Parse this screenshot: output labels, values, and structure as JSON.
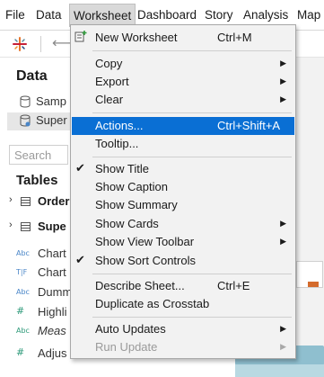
{
  "menubar": {
    "items": [
      "File",
      "Data",
      "Worksheet",
      "Dashboard",
      "Story",
      "Analysis",
      "Map"
    ]
  },
  "data_pane": {
    "title": "Data",
    "sources": [
      "Samp",
      "Super"
    ],
    "search_placeholder": "Search",
    "tables_title": "Tables",
    "tables": [
      "Order",
      "Supe"
    ],
    "fields": [
      {
        "type": "Abc",
        "label": "Chart"
      },
      {
        "type": "T|F",
        "label": "Chart"
      },
      {
        "type": "Abc",
        "label": "Dumm"
      },
      {
        "type": "#",
        "label": "Highli"
      },
      {
        "type": "Abc",
        "label": "Meas"
      },
      {
        "type": "#",
        "label": "Adjus"
      }
    ]
  },
  "menu": {
    "new_worksheet": {
      "label": "New Worksheet",
      "shortcut": "Ctrl+M"
    },
    "copy": "Copy",
    "export": "Export",
    "clear": "Clear",
    "actions": {
      "label": "Actions...",
      "shortcut": "Ctrl+Shift+A"
    },
    "tooltip": "Tooltip...",
    "show_title": "Show Title",
    "show_caption": "Show Caption",
    "show_summary": "Show Summary",
    "show_cards": "Show Cards",
    "show_view_toolbar": "Show View Toolbar",
    "show_sort_controls": "Show Sort Controls",
    "describe_sheet": {
      "label": "Describe Sheet...",
      "shortcut": "Ctrl+E"
    },
    "duplicate_crosstab": "Duplicate as Crosstab",
    "auto_updates": "Auto Updates",
    "run_update": "Run Update",
    "glyphs": {
      "check": "✔",
      "arrow": "▶"
    }
  },
  "colors": {
    "highlight": "#0a6fd4",
    "menu_bg": "#f2f2f2"
  }
}
